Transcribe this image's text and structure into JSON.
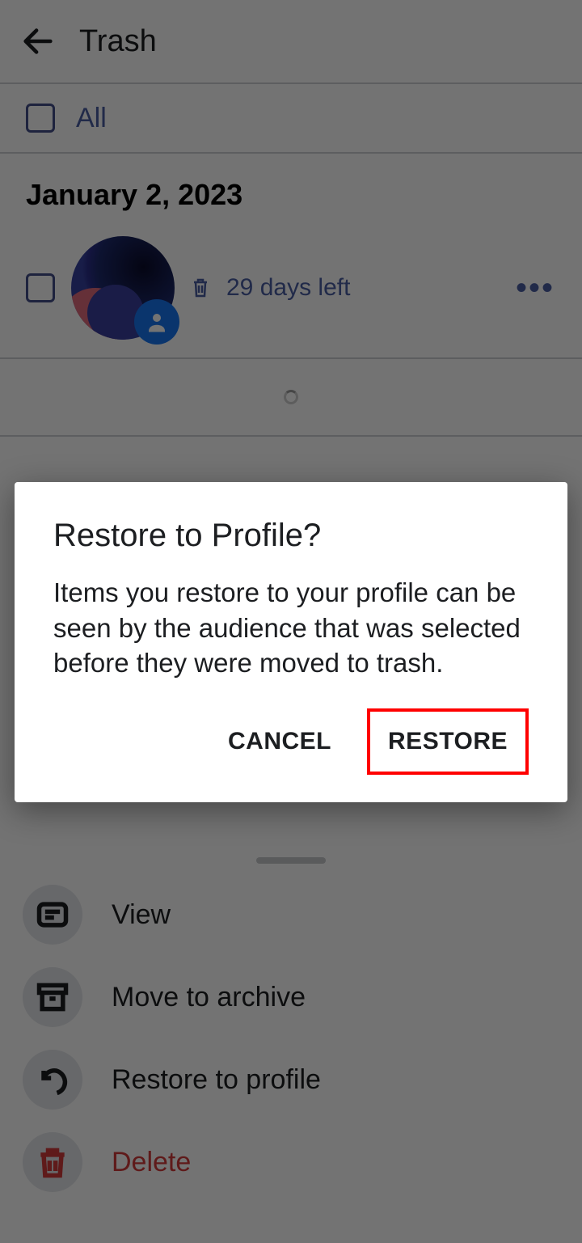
{
  "header": {
    "title": "Trash"
  },
  "all_row": {
    "label": "All"
  },
  "date_group": {
    "date": "January 2, 2023"
  },
  "item": {
    "days_left_label": "29 days left",
    "more_glyph": "•••"
  },
  "sheet": {
    "view": "View",
    "archive": "Move to archive",
    "restore": "Restore to profile",
    "delete": "Delete"
  },
  "dialog": {
    "title": "Restore to Profile?",
    "body": "Items you restore to your profile can be seen by the audience that was selected before they were moved to trash.",
    "cancel": "CANCEL",
    "restore": "RESTORE"
  }
}
